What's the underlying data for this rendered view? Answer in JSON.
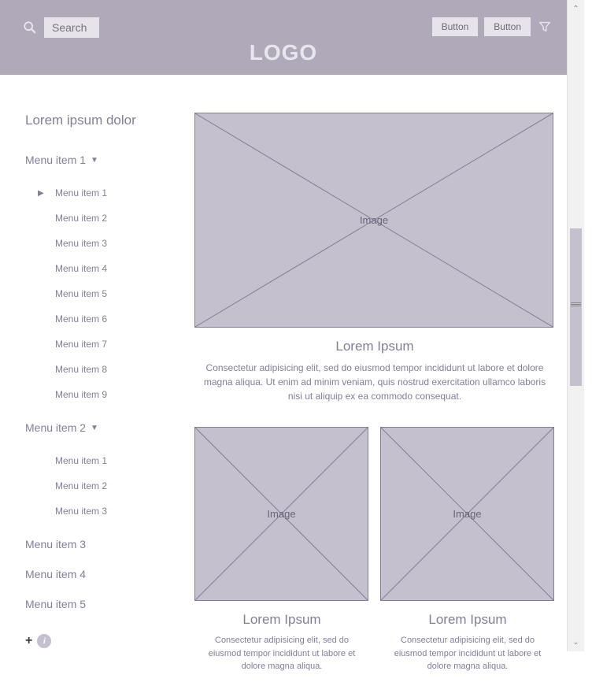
{
  "header": {
    "search_placeholder": "Search",
    "button1_label": "Button",
    "button2_label": "Button",
    "logo_text": "LOGO"
  },
  "sidebar": {
    "title": "Lorem ipsum dolor",
    "group1": {
      "label": "Menu item 1",
      "items": [
        {
          "label": "Menu item 1"
        },
        {
          "label": "Menu item 2"
        },
        {
          "label": "Menu item 3"
        },
        {
          "label": "Menu item 4"
        },
        {
          "label": "Menu item 5"
        },
        {
          "label": "Menu item 6"
        },
        {
          "label": "Menu item 7"
        },
        {
          "label": "Menu item 8"
        },
        {
          "label": "Menu item 9"
        }
      ]
    },
    "group2": {
      "label": "Menu item 2",
      "items": [
        {
          "label": "Menu item 1"
        },
        {
          "label": "Menu item 2"
        },
        {
          "label": "Menu item 3"
        }
      ]
    },
    "item3": "Menu item 3",
    "item4": "Menu item 4",
    "item5": "Menu item 5"
  },
  "main": {
    "image_label": "Image",
    "big_card": {
      "title": "Lorem Ipsum",
      "desc": "Consectetur adipisicing elit, sed do eiusmod tempor incididunt ut labore et dolore magna aliqua. Ut enim ad minim veniam, quis nostrud exercitation ullamco laboris nisi ut aliquip ex ea commodo consequat."
    },
    "small_card1": {
      "title": "Lorem Ipsum",
      "desc": "Consectetur adipisicing elit, sed do eiusmod tempor incididunt ut labore et dolore magna aliqua."
    },
    "small_card2": {
      "title": "Lorem Ipsum",
      "desc": "Consectetur adipisicing elit, sed do eiusmod tempor incididunt ut labore et dolore magna aliqua."
    }
  }
}
